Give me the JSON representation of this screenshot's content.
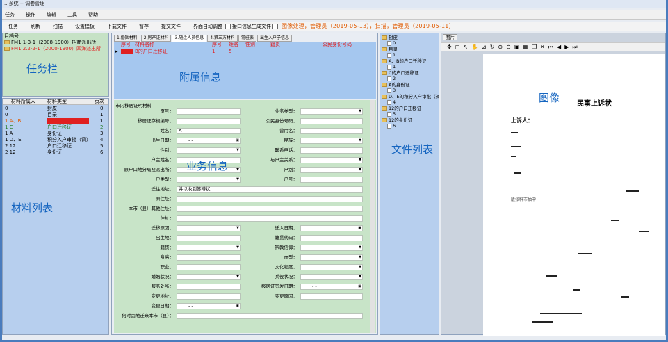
{
  "title": "...系统 -- 调卷管理",
  "menu": [
    "任务",
    "操作",
    "编辑",
    "工具",
    "帮助"
  ],
  "toolbar": {
    "buttons": [
      "任务",
      "刷新",
      "扫描",
      "设置模板",
      "下载文件",
      "暂存",
      "提交文件",
      "界面自动调整"
    ],
    "checkbox_label": "接口信息生成文件",
    "notice": "图像处理，管理员（2019-05-13），扫描，管理员（2019-05-11）"
  },
  "labels": {
    "task_bar": "任务栏",
    "attached_info": "附属信息",
    "business_info": "业务信息",
    "file_list": "文件列表",
    "image": "图像",
    "material_list": "材料列表"
  },
  "task": {
    "header": "目档号",
    "rows": [
      "FM1.1-3-1（2008-1900）招商派出所",
      "FM1.2.2-2-1（2000-1900）四海派出所"
    ]
  },
  "materials": {
    "columns": [
      "材料所属人",
      "材料类型",
      "页次"
    ],
    "rows": [
      {
        "owner": "0",
        "type": "封皮",
        "page": "0"
      },
      {
        "owner": "0",
        "type": "目录",
        "page": "1"
      },
      {
        "owner": "1 A、B",
        "type": "",
        "page": "1"
      },
      {
        "owner": "1 C",
        "type": "户口迁移证",
        "page": "2"
      },
      {
        "owner": "1 A",
        "type": "身份证",
        "page": "3"
      },
      {
        "owner": "1 D、E",
        "type": "积分入户审批（调）",
        "page": "4"
      },
      {
        "owner": "2 12",
        "type": "户口迁移证",
        "page": "5"
      },
      {
        "owner": "2 12",
        "type": "身份证",
        "page": "6"
      }
    ]
  },
  "mid_tabs": [
    "1.婚姻材料",
    "2.房产证材料",
    "3.随迁人员信息",
    "4.第三方材料",
    "常驻表",
    "出生入户子信息"
  ],
  "grid": {
    "columns": [
      "序号",
      "材料名称",
      "序号",
      "姓名",
      "性别",
      "籍贯",
      "公民身份号码"
    ],
    "row": {
      "no": "",
      "name": "B的户口迁移证",
      "seq": "1",
      "flag": "5"
    }
  },
  "form": {
    "title": "市内移居证明材料",
    "left_labels": [
      "页号：",
      "移居证存根编号：",
      "姓名：",
      "出生日期：",
      "性别：",
      "户主姓名：",
      "原户口地分局及派出所：",
      "户类型：",
      "迁往地址：",
      "原住址：",
      "本市（县）其他住址：",
      "住址：",
      "迁移原因：",
      "出生地：",
      "籍贯：",
      "身高：",
      "职业：",
      "婚姻状况：",
      "服务处所：",
      "变更地址：",
      "变更日期：",
      "何时因地迁来本市（县）："
    ],
    "right_labels": [
      "业务类型：",
      "公民身份号码：",
      "曾用名：",
      "民族：",
      "联系电话：",
      "与户主关系：",
      "户别：",
      "户号：",
      "迁入日期：",
      "籍贯代码：",
      "宗教信仰：",
      "血型：",
      "文化程度：",
      "兵役状况：",
      "移居证签发日期：",
      "变更原因："
    ],
    "name_value": "A",
    "address_value": "并以收到答辩状",
    "date_placeholder": "- -"
  },
  "files": [
    {
      "folder": "封皮",
      "count": "0"
    },
    {
      "folder": "目录",
      "count": "1"
    },
    {
      "folder": "A、B的户口迁移证",
      "count": "1"
    },
    {
      "folder": "C的户口迁移证",
      "count": "2"
    },
    {
      "folder": "A的身份证",
      "count": "3"
    },
    {
      "folder": "D、E的积分入户审批（调）",
      "count": "4"
    },
    {
      "folder": "12的户口迁移证",
      "count": "5"
    },
    {
      "folder": "12的身份证",
      "count": "6"
    }
  ],
  "image": {
    "tab": "图片",
    "doc_title": "民事上诉状",
    "line1": "上诉人：",
    "line2": "版张料市抽中"
  },
  "colors": {
    "accent": "#1565c0",
    "notice": "#e05a00",
    "selected_row": "#e02020",
    "green_text": "#1f7a1f"
  }
}
